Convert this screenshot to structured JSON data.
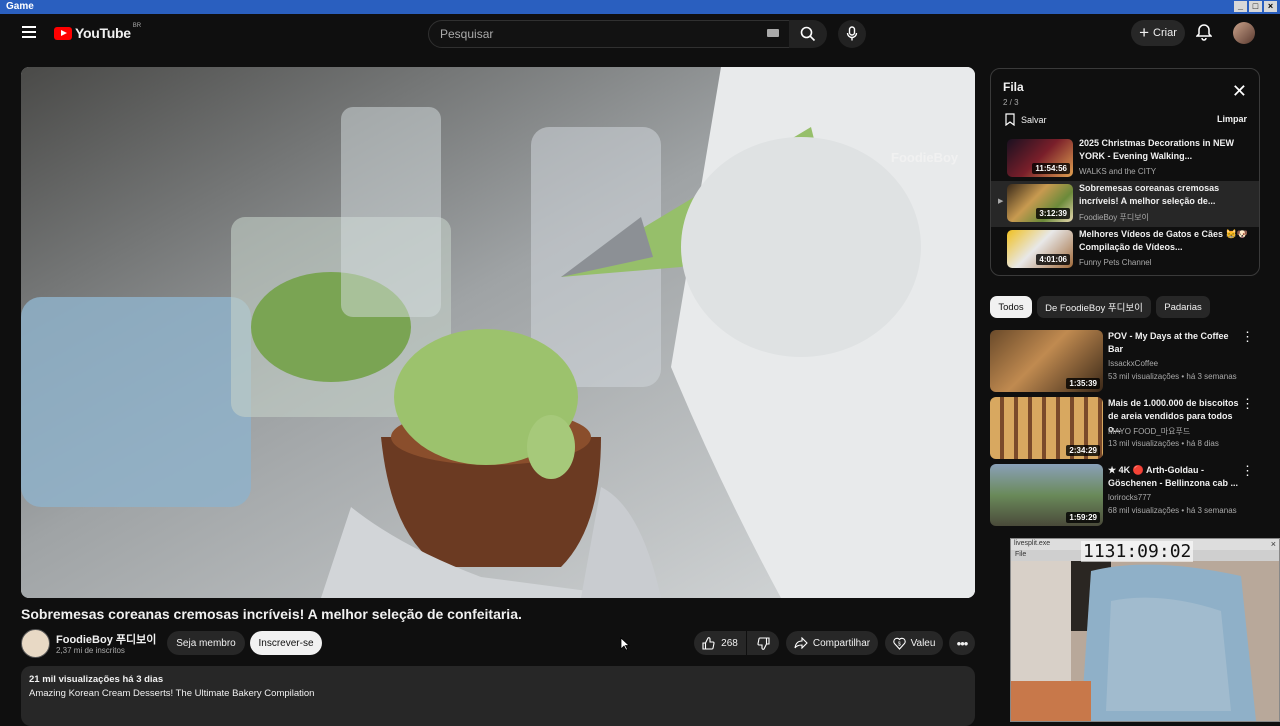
{
  "window": {
    "title": "Game"
  },
  "header": {
    "logo_text": "YouTube",
    "logo_country": "BR",
    "search_placeholder": "Pesquisar",
    "create_label": "Criar"
  },
  "video": {
    "title": "Sobremesas coreanas cremosas incríveis! A melhor seleção de confeitaria.",
    "watermark": "FoodieBoy",
    "channel": "FoodieBoy 푸디보이",
    "subscribers": "2,37 mi de inscritos",
    "member_label": "Seja membro",
    "subscribe_label": "Inscrever-se",
    "likes": "268",
    "share_label": "Compartilhar",
    "thanks_label": "Valeu",
    "views_date": "21 mil visualizações  há 3 dias",
    "description": "Amazing Korean Cream Desserts! The Ultimate Bakery Compilation"
  },
  "queue": {
    "title": "Fila",
    "count": "2 / 3",
    "save_label": "Salvar",
    "clear_label": "Limpar",
    "items": [
      {
        "title": "2025 Christmas Decorations in NEW YORK - Evening Walking...",
        "channel": "WALKS and the CITY",
        "duration": "11:54:56"
      },
      {
        "title": "Sobremesas coreanas cremosas incríveis! A melhor seleção de...",
        "channel": "FoodieBoy 푸디보이",
        "duration": "3:12:39"
      },
      {
        "title": "Melhores Vídeos de Gatos e Cães 😸🐶 Compilação de Vídeos...",
        "channel": "Funny Pets Channel",
        "duration": "4:01:06"
      }
    ]
  },
  "chips": [
    "Todos",
    "De FoodieBoy 푸디보이",
    "Padarias"
  ],
  "recommendations": [
    {
      "title": "POV - My Days at the Coffee Bar",
      "channel": "IssackxCoffee",
      "views": "53 mil visualizações • há 3 semanas",
      "duration": "1:35:39"
    },
    {
      "title": "Mais de 1.000.000 de biscoitos de areia vendidos para todos o...",
      "channel": "MAYO FOOD_마요푸드",
      "views": "13 mil visualizações • há 8 dias",
      "duration": "2:34:29"
    },
    {
      "title": "★ 4K 🔴 Arth-Goldau - Göschenen - Bellinzona cab ...",
      "channel": "lorirocks777",
      "views": "68 mil visualizações • há 3 semanas",
      "duration": "1:59:29"
    }
  ],
  "overlay": {
    "title": "livesplit.exe",
    "menu": "File",
    "timer": "1131:09:02"
  }
}
